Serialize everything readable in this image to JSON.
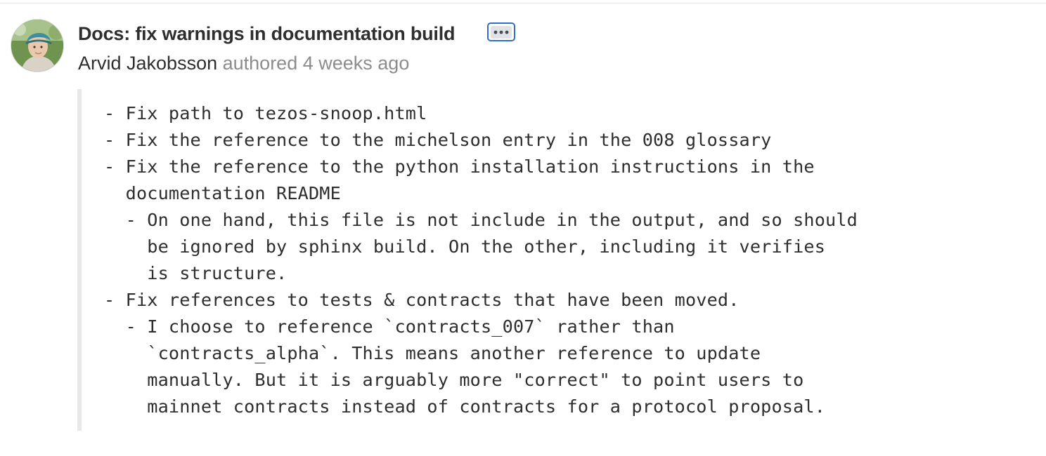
{
  "commit": {
    "title": "Docs: fix warnings in documentation build",
    "author": "Arvid Jakobsson",
    "authored_label": "authored",
    "time_ago": "4 weeks ago",
    "toggle_label": "•••"
  },
  "description": {
    "lines": [
      "- Fix path to tezos-snoop.html",
      "- Fix the reference to the michelson entry in the 008 glossary",
      "- Fix the reference to the python installation instructions in the",
      "  documentation README",
      "  - On one hand, this file is not include in the output, and so should",
      "    be ignored by sphinx build. On the other, including it verifies",
      "    is structure.",
      "- Fix references to tests & contracts that have been moved.",
      "  - I choose to reference `contracts_007` rather than",
      "    `contracts_alpha`. This means another reference to update",
      "    manually. But it is arguably more \"correct\" to point users to",
      "    mainnet contracts instead of contracts for a protocol proposal."
    ]
  },
  "colors": {
    "title": "#2e2e2e",
    "muted": "#8c8c8c",
    "toggle_border": "#2f6fc9",
    "quote_bar": "#e8e8e8"
  }
}
